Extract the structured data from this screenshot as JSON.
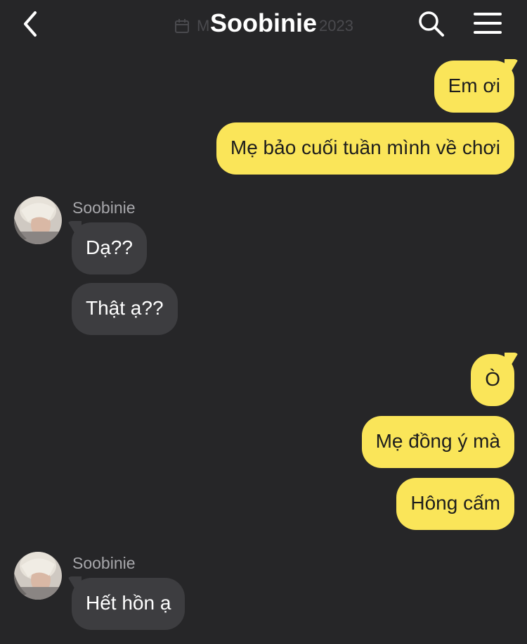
{
  "header": {
    "title": "Soobinie",
    "date_hint_left": "M",
    "date_hint_right": "2023"
  },
  "messages": [
    {
      "side": "out",
      "text": "Em ơi"
    },
    {
      "side": "out",
      "text": "Mẹ bảo cuối tuần mình về chơi"
    },
    {
      "side": "in",
      "sender": "Soobinie",
      "text": "Dạ??"
    },
    {
      "side": "in",
      "text": "Thật ạ??"
    },
    {
      "side": "out",
      "text": "Ò"
    },
    {
      "side": "out",
      "text": "Mẹ đồng ý mà"
    },
    {
      "side": "out",
      "text": "Hông cấm"
    },
    {
      "side": "in",
      "sender": "Soobinie",
      "text": "Hết hồn ạ"
    }
  ],
  "colors": {
    "background": "#262628",
    "outgoing_bubble": "#fae559",
    "incoming_bubble": "#3d3d40"
  },
  "icons": [
    "back-chevron-icon",
    "calendar-icon",
    "search-icon",
    "menu-icon",
    "avatar"
  ]
}
